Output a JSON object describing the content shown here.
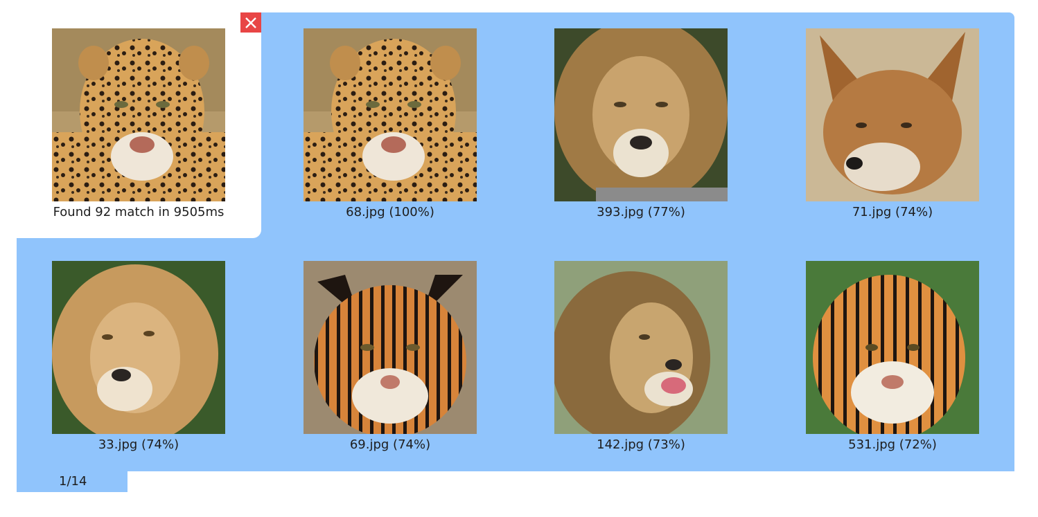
{
  "query": {
    "status": "Found 92 match in 9505ms",
    "image_subject": "jaguar"
  },
  "close_button": {
    "icon": "close-icon",
    "color": "#e84545"
  },
  "results": [
    {
      "caption": "68.jpg (100%)",
      "subject": "jaguar"
    },
    {
      "caption": "393.jpg (77%)",
      "subject": "lion"
    },
    {
      "caption": "71.jpg (74%)",
      "subject": "fox"
    },
    {
      "caption": "33.jpg (74%)",
      "subject": "lion"
    },
    {
      "caption": "69.jpg (74%)",
      "subject": "tiger"
    },
    {
      "caption": "142.jpg (73%)",
      "subject": "lion"
    },
    {
      "caption": "531.jpg (72%)",
      "subject": "tiger"
    }
  ],
  "pagination": {
    "label": "1/14"
  },
  "colors": {
    "results_background": "#90c4fc",
    "panel_background": "#ffffff"
  }
}
